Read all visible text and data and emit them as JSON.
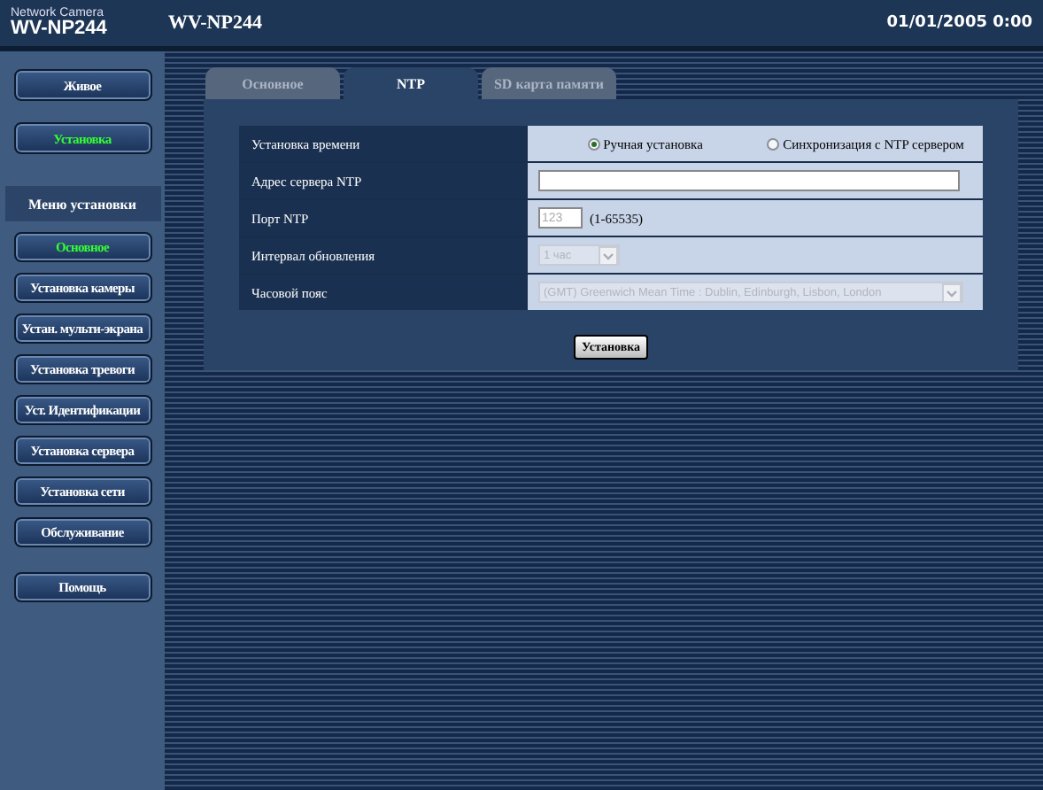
{
  "header": {
    "product_label": "Network Camera",
    "model": "WV-NP244",
    "title": "WV-NP244",
    "datetime": "01/01/2005  0:00"
  },
  "sidebar": {
    "top_buttons": [
      {
        "label": "Живое",
        "selected": false
      },
      {
        "label": "Установка",
        "selected": true
      }
    ],
    "menu_title": "Меню установки",
    "menu_items": [
      {
        "label": "Основное",
        "selected": true
      },
      {
        "label": "Установка камеры",
        "selected": false
      },
      {
        "label": "Устан. мульти-экрана",
        "selected": false
      },
      {
        "label": "Установка тревоги",
        "selected": false
      },
      {
        "label": "Уст. Идентификации",
        "selected": false
      },
      {
        "label": "Установка сервера",
        "selected": false
      },
      {
        "label": "Установка сети",
        "selected": false
      },
      {
        "label": "Обслуживание",
        "selected": false
      }
    ],
    "help_button": "Помощь"
  },
  "tabs": [
    {
      "label": "Основное",
      "selected": false
    },
    {
      "label": "NTP",
      "selected": true
    },
    {
      "label": "SD карта памяти",
      "selected": false
    }
  ],
  "form": {
    "rows": [
      {
        "kind": "radio",
        "label": "Установка времени",
        "options": [
          {
            "label": "Ручная установка",
            "selected": true
          },
          {
            "label": "Синхронизация с NTP сервером",
            "selected": false
          }
        ]
      },
      {
        "kind": "text",
        "label": "Адрес сервера NTP"
      },
      {
        "kind": "port",
        "label": "Порт NTP",
        "value": "123",
        "hint": "(1-65535)",
        "disabled": true
      },
      {
        "kind": "select",
        "label": "Интервал обновления",
        "value": "1 час",
        "disabled": true
      },
      {
        "kind": "select",
        "label": "Часовой пояс",
        "value": "(GMT) Greenwich Mean Time : Dublin, Edinburgh, Lisbon, London",
        "disabled": true
      }
    ],
    "submit": "Установка"
  }
}
